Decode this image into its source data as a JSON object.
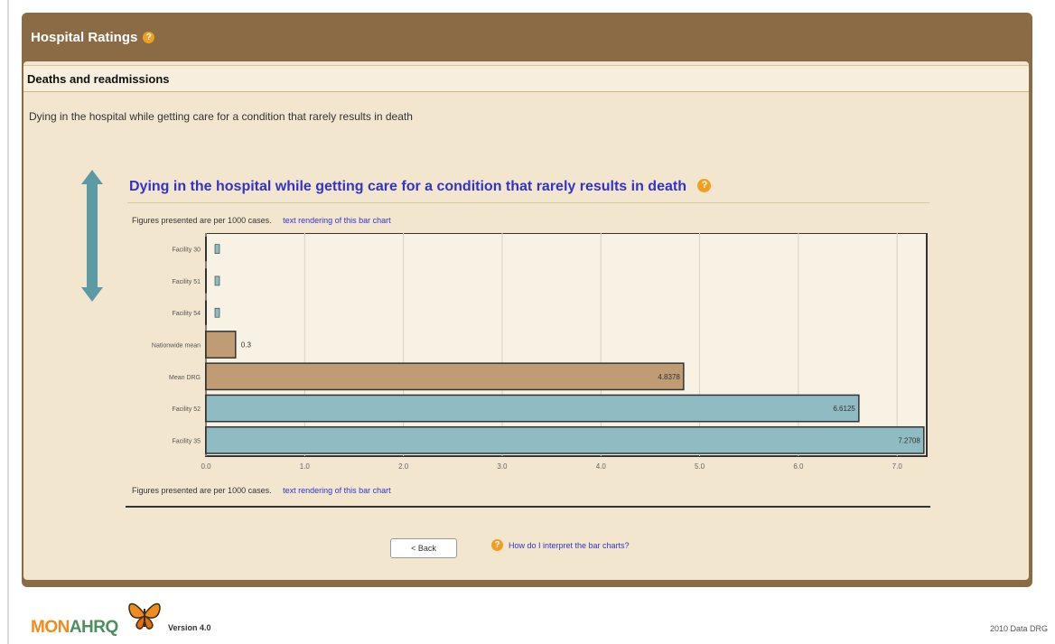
{
  "header": {
    "title": "Hospital Ratings",
    "help_icon": "question-mark"
  },
  "section": {
    "title": "Deaths and readmissions"
  },
  "description": "Dying in the hospital while getting care for a condition that rarely results in death",
  "chart_header": {
    "title": "Dying in the hospital while getting care for a condition that rarely results in death",
    "note": "Figures presented are per 1000 cases.",
    "text_link": "text rendering of this bar chart"
  },
  "chart_data": {
    "type": "bar",
    "orientation": "horizontal",
    "categories": [
      "Facility 30",
      "Facility 51",
      "Facility 54",
      "Nationwide mean",
      "Mean DRG",
      "Facility 52",
      "Facility 35"
    ],
    "values": [
      0,
      0,
      0,
      0.3,
      4.8378,
      6.6125,
      7.2708
    ],
    "value_labels": [
      "",
      "",
      "",
      "0.3",
      "4.8378",
      "6.6125",
      "7.2708"
    ],
    "colors": [
      "#8fbcc2",
      "#8fbcc2",
      "#8fbcc2",
      "#c09c74",
      "#c09c74",
      "#8fbcc2",
      "#8fbcc2"
    ],
    "xlim": [
      0,
      7.3
    ],
    "xticks": [
      "0.0",
      "1.0",
      "2.0",
      "3.0",
      "4.0",
      "5.0",
      "6.0",
      "7.0"
    ],
    "grid": true
  },
  "footer": {
    "logo_mon": "MON",
    "logo_ahrq": "AHRQ",
    "version": "Version 4.0",
    "data_year": "2010 Data DRG"
  },
  "actions": {
    "back": "< Back",
    "interpret": "How do I interpret the bar charts?"
  }
}
